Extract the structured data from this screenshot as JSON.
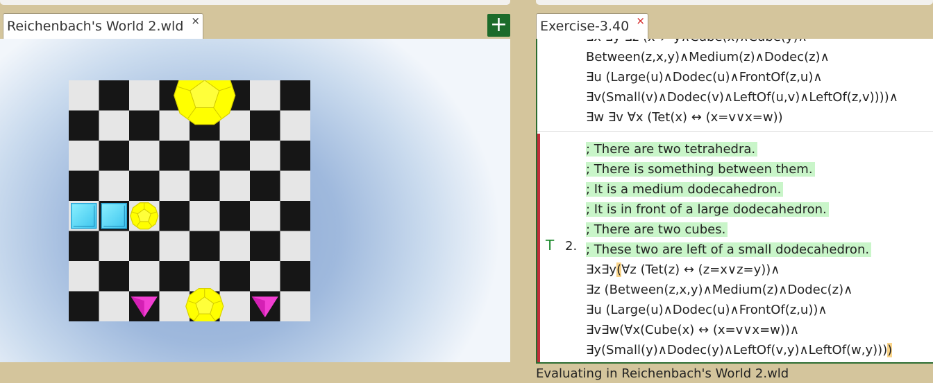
{
  "world_panel": {
    "tab_label": "Reichenbach's World 2.wld",
    "close_glyph": "×",
    "add_glyph": "+"
  },
  "board": {
    "size": 8,
    "objects": [
      {
        "shape": "dodec",
        "size": "large",
        "col": 4,
        "row": 0,
        "color": "#ffff00"
      },
      {
        "shape": "cube",
        "size": "small",
        "col": 0,
        "row": 4,
        "color": "#5cd9f7"
      },
      {
        "shape": "cube",
        "size": "small",
        "col": 1,
        "row": 4,
        "color": "#5cd9f7"
      },
      {
        "shape": "dodec",
        "size": "small",
        "col": 2,
        "row": 4,
        "color": "#ffff00"
      },
      {
        "shape": "tet",
        "size": "small",
        "col": 2,
        "row": 7,
        "color": "#f23fd2"
      },
      {
        "shape": "dodec",
        "size": "medium",
        "col": 4,
        "row": 7,
        "color": "#ffff00"
      },
      {
        "shape": "tet",
        "size": "small",
        "col": 6,
        "row": 7,
        "color": "#f23fd2"
      }
    ]
  },
  "editor": {
    "tab_label": "Exercise-3.40",
    "close_glyph": "×",
    "prev_lines": [
      "∃x ∃y ∃z (x ≠ y∧Cube(x)∧Cube(y)∧",
      "Between(z,x,y)∧Medium(z)∧Dodec(z)∧",
      "∃u (Large(u)∧Dodec(u)∧FrontOf(z,u)∧",
      "∃v(Small(v)∧Dodec(v)∧LeftOf(u,v)∧LeftOf(z,v))))∧",
      "∃w ∃v ∀x (Tet(x) ↔ (x=v∨x=w))"
    ],
    "sentence": {
      "truth": "T",
      "number": "2.",
      "comments": [
        "; There are two tetrahedra.",
        "; There is something between them.",
        "; It is a medium dodecahedron.",
        "; It is in front of a large dodecahedron.",
        "; There are two cubes.",
        "; These two are left of a small dodecahedron."
      ],
      "line1_a": "∃x∃y",
      "line1_paren": "(",
      "line1_b": "∀z (Tet(z) ↔ (z=x∨z=y))∧",
      "line2": "∃z (Between(z,x,y)∧Medium(z)∧Dodec(z)∧",
      "line3": "∃u (Large(u)∧Dodec(u)∧FrontOf(z,u))∧",
      "line4": "∃v∃w(∀x(Cube(x) ↔ (x=v∨x=w))∧",
      "line5_a": "∃y(Small(y)∧Dodec(y)∧LeftOf(v,y)∧LeftOf(w,y)))",
      "line5_paren": ")"
    }
  },
  "status": "Evaluating in Reichenbach's World 2.wld"
}
